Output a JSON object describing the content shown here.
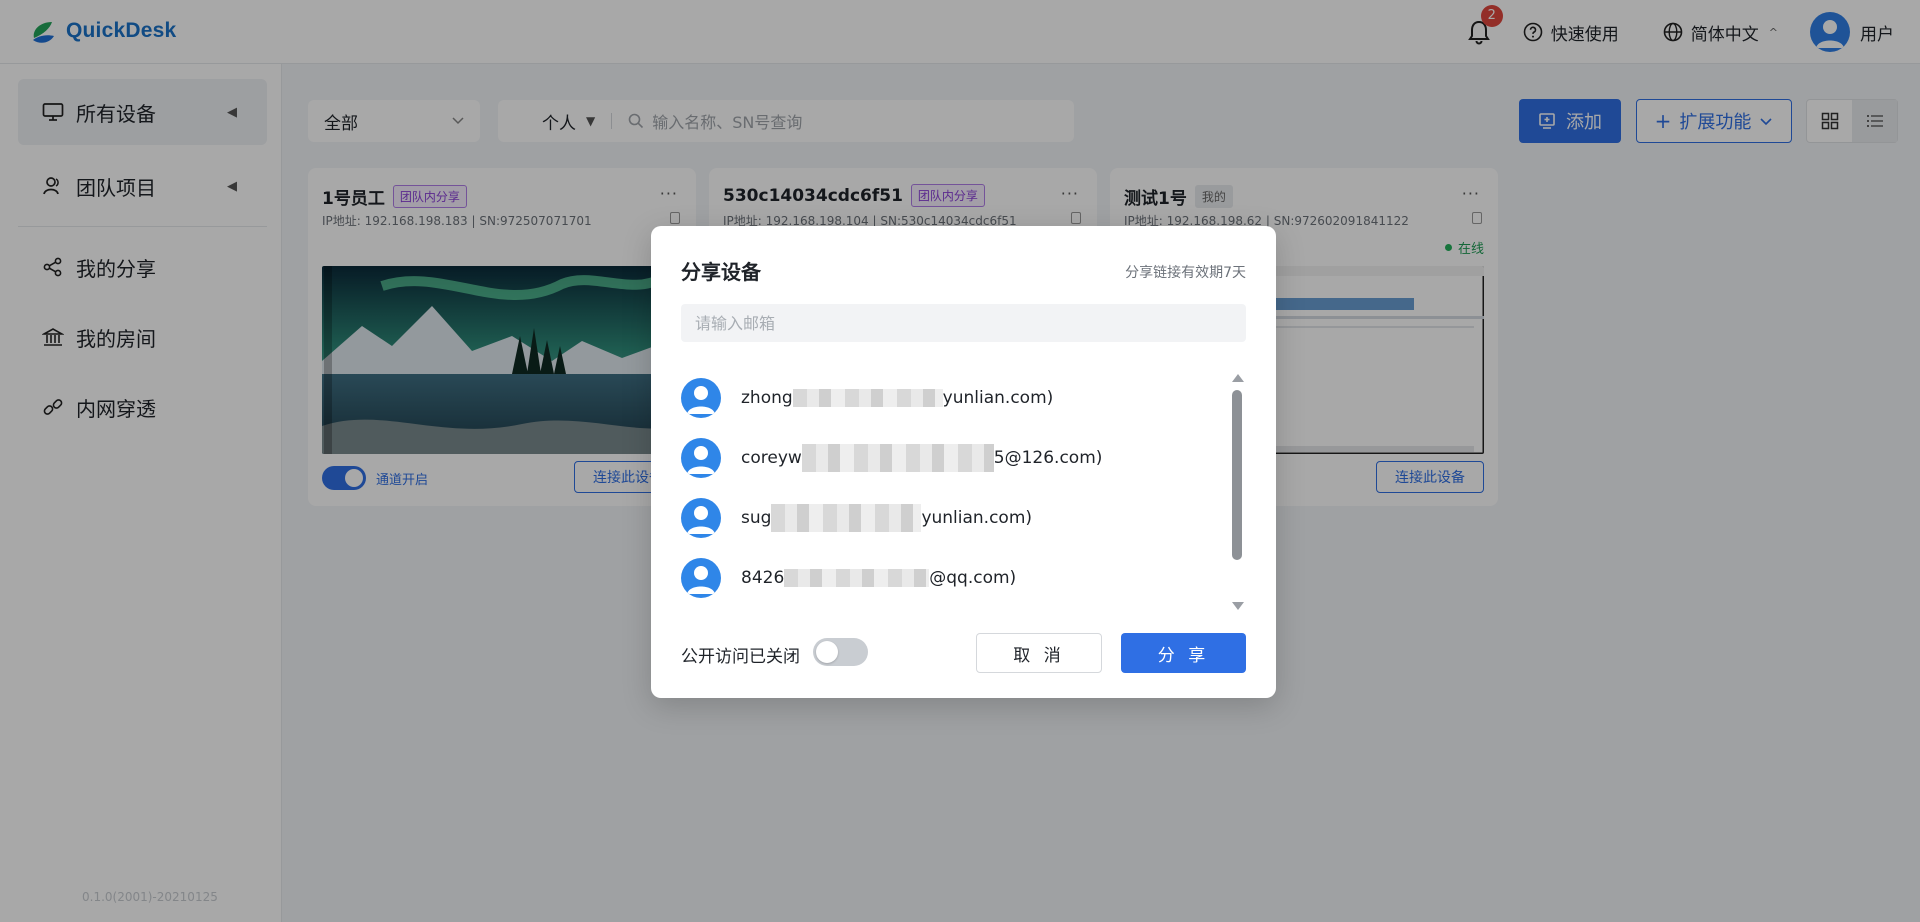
{
  "header": {
    "app_name": "QuickDesk",
    "notification_count": "2",
    "quick_start": "快速使用",
    "language": "简体中文",
    "user": "用户"
  },
  "sidebar": {
    "items": [
      {
        "label": "所有设备",
        "icon": "monitor-icon",
        "active": true
      },
      {
        "label": "团队项目",
        "icon": "team-icon"
      },
      {
        "label": "我的分享",
        "icon": "share-icon"
      },
      {
        "label": "我的房间",
        "icon": "room-icon"
      },
      {
        "label": "内网穿透",
        "icon": "link-icon"
      }
    ],
    "version": "0.1.0(2001)-20210125"
  },
  "toolbar": {
    "filter": "全部",
    "search_scope": "个人",
    "search_placeholder": "输入名称、SN号查询",
    "add_label": "添加",
    "extend_label": "扩展功能"
  },
  "cards": [
    {
      "name": "1号员工",
      "tag": "团队内分享",
      "ip": "IP地址: 192.168.198.183 | SN:972507071701",
      "toggle_label": "通道开启",
      "connect_label": "连接此设备"
    },
    {
      "name": "530c14034cdc6f51",
      "tag": "团队内分享",
      "ip": "IP地址: 192.168.198.104 | SN:530c14034cdc6f51"
    },
    {
      "name": "测试1号",
      "tag": "我的",
      "ip": "IP地址: 192.168.198.62 | SN:972602091841122",
      "status": "在线",
      "connect_label": "连接此设备"
    }
  ],
  "modal": {
    "title": "分享设备",
    "hint": "分享链接有效期7天",
    "email_placeholder": "请输入邮箱",
    "users": [
      {
        "prefix": "zhong",
        "suffix": "yunlian.com)"
      },
      {
        "prefix": "coreyw",
        "suffix": "5@126.com)"
      },
      {
        "prefix": "sug",
        "suffix": "yunlian.com)"
      },
      {
        "prefix": "8426",
        "suffix": "@qq.com)"
      }
    ],
    "public_label": "公开访问已关闭",
    "cancel": "取 消",
    "share": "分 享"
  },
  "colors": {
    "accent": "#2f6fe4",
    "team_tag": "#8a3fd8",
    "online": "#23b15b",
    "badge": "#e0463d"
  }
}
